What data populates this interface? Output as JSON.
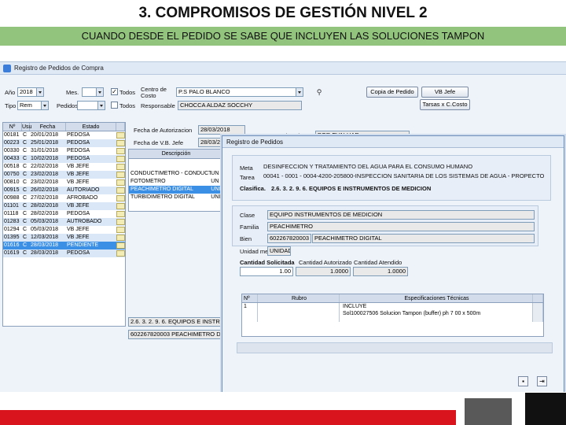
{
  "slide": {
    "title": "3. COMPROMISOS DE GESTIÓN NIVEL 2",
    "subtitle": "CUANDO DESDE EL PEDIDO SE SABE QUE INCLUYEN LAS SOLUCIONES TAMPON"
  },
  "window": {
    "title": "Registro de Pedidos de Compra"
  },
  "filters": {
    "anio_label": "Año",
    "anio_value": "2018",
    "mes_label": "Mes.",
    "mes_value": "",
    "todos_label": "Todos",
    "centro_label": "Centro de Costo",
    "centro_value": "P.S PALO BLANCO",
    "tipo_label": "Tipo",
    "tipo_value": "Rem",
    "pedidos_label": "Pedidos",
    "pedidos_value": "",
    "responsable_label": "Responsable",
    "responsable_value": "CHOCCA ALDAZ SOCCHY",
    "copia_button": "Copia de Pedido",
    "vb_button": "VB Jefe",
    "tarsas_button": "Tarsas x C.Costo"
  },
  "pedido_info": {
    "fecha_aut_label": "Fecha de Autorizacion",
    "fecha_aut_value": "28/03/2018",
    "fecha_vb_label": "Fecha de V.B. Jefe",
    "fecha_vb_value": "28/03/201",
    "estado_label": "Estado col Item",
    "estado_value": "POR EVALUAR"
  },
  "orders": {
    "headers": [
      "Nº",
      "Usu",
      "Fecha",
      "Estado"
    ],
    "rows": [
      {
        "n": "00181",
        "u": "C",
        "fecha": "20/01/2018",
        "estado": "PEDOSA"
      },
      {
        "n": "00223",
        "u": "C",
        "fecha": "25/01/2018",
        "estado": "PEDOSA"
      },
      {
        "n": "00330",
        "u": "C",
        "fecha": "31/01/2018",
        "estado": "PEDOSA"
      },
      {
        "n": "00433",
        "u": "C",
        "fecha": "10/02/2018",
        "estado": "PEDOSA"
      },
      {
        "n": "00518",
        "u": "C",
        "fecha": "22/02/2018",
        "estado": "VB JEFE"
      },
      {
        "n": "00750",
        "u": "C",
        "fecha": "23/02/2018",
        "estado": "VB JEFE"
      },
      {
        "n": "00810",
        "u": "C",
        "fecha": "23/02/2018",
        "estado": "VB JEFE"
      },
      {
        "n": "00915",
        "u": "C",
        "fecha": "26/02/2018",
        "estado": "AUTORIADO"
      },
      {
        "n": "00988",
        "u": "C",
        "fecha": "27/02/2018",
        "estado": "AFROBADO"
      },
      {
        "n": "01101",
        "u": "C",
        "fecha": "28/02/2018",
        "estado": "VB JEFE"
      },
      {
        "n": "01118",
        "u": "C",
        "fecha": "28/02/2018",
        "estado": "PEDOSA"
      },
      {
        "n": "01283",
        "u": "C",
        "fecha": "05/03/2018",
        "estado": "AUTROBADO"
      },
      {
        "n": "01294",
        "u": "C",
        "fecha": "05/03/2018",
        "estado": "VB JEFE"
      },
      {
        "n": "01395",
        "u": "C",
        "fecha": "12/03/2018",
        "estado": "VB JEFE"
      },
      {
        "n": "01616",
        "u": "C",
        "fecha": "28/03/2018",
        "estado": "PENDIENTE"
      },
      {
        "n": "01619",
        "u": "C",
        "fecha": "28/03/2018",
        "estado": "PEDOSA"
      }
    ]
  },
  "products": {
    "header": "Descripción",
    "rows": [
      {
        "desc": "CONDUCTIMETRO - CONDUCTIMETR",
        "unit": "UN"
      },
      {
        "desc": "FOTOMETRO",
        "unit": "UN"
      },
      {
        "desc": "PEACHIMETRO DIGITAL",
        "unit": "UNI"
      },
      {
        "desc": "TURBIDIMETRO DIGITAL",
        "unit": "UNI"
      }
    ],
    "clasif_text": "2.6. 3. 2. 9. 6. EQUIPOS E INSTRU",
    "bien_text": "602267820003 PEACHIMETRO DIG"
  },
  "dialog": {
    "title": "Registro de Pedidos",
    "meta_label": "Meta",
    "meta_value": "DESINFECCION Y TRATAMIENTO DEL AGUA PARA EL CONSUMO HUMANO",
    "tarea_label": "Tarea",
    "tarea_value": "00041 - 0001 - 0004-4200-205800-INSPECCION SANITARIA DE LOS SISTEMAS DE AGUA - PROPECTO",
    "clasif_label": "Clasifica.",
    "clasif_value": "2.6. 3. 2. 9. 6. EQUIPOS E INSTRUMENTOS DE MEDICION",
    "clase_label": "Clase",
    "clase_value": "EQUIPO INSTRUMENTOS DE MEDICION",
    "familia_label": "Familia",
    "familia_value": "PEACHIMETRO",
    "bien_label": "Bien",
    "bien_code": "602267820003",
    "bien_desc": "PEACHIMETRO DIGITAL",
    "unidad_label": "Unidad med",
    "unidad_value": "UNIDAD",
    "qty_headers": {
      "solicitada": "Cantidad Solicitada",
      "autorizada": "Cantidad Autorizado",
      "atendida": "Cantidad Atendido"
    },
    "qty_values": {
      "solicitada": "1.00",
      "autorizada": "1.0000",
      "atendida": "1.0000"
    },
    "spec_headers": [
      "Nº",
      "Rubro",
      "Especificaciones Técnicas"
    ],
    "spec_row": {
      "n": "1",
      "rubro": "",
      "line1": "INCLUYE",
      "line2": "Sol100027506 Solucion Tampon (buffer) ph 7 00 x 500m"
    }
  }
}
